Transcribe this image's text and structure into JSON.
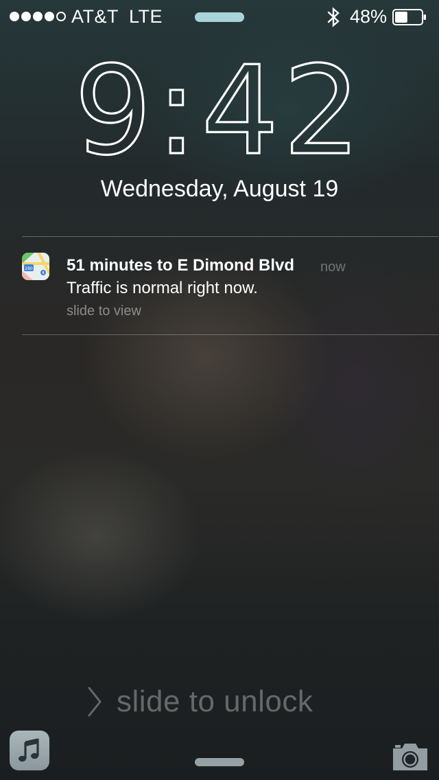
{
  "status_bar": {
    "signal_bars_filled": 4,
    "signal_bars_total": 5,
    "carrier": "AT&T",
    "network": "LTE",
    "bluetooth_icon": "bluetooth-icon",
    "battery_percent": "48%",
    "battery_level": 0.48
  },
  "lock_screen": {
    "time": "9:42",
    "date": "Wednesday, August 19"
  },
  "notification": {
    "app_icon": "maps-app-icon",
    "title": "51 minutes to E Dimond Blvd",
    "time": "now",
    "body": "Traffic is normal right now.",
    "action": "slide to view"
  },
  "unlock": {
    "chevron_icon": "chevron-right-icon",
    "label": "slide to unlock"
  },
  "bottom": {
    "left_icon": "music-note-icon",
    "right_icon": "camera-icon"
  },
  "colors": {
    "call_pill": "#a8d3d8",
    "text": "#ffffff"
  }
}
